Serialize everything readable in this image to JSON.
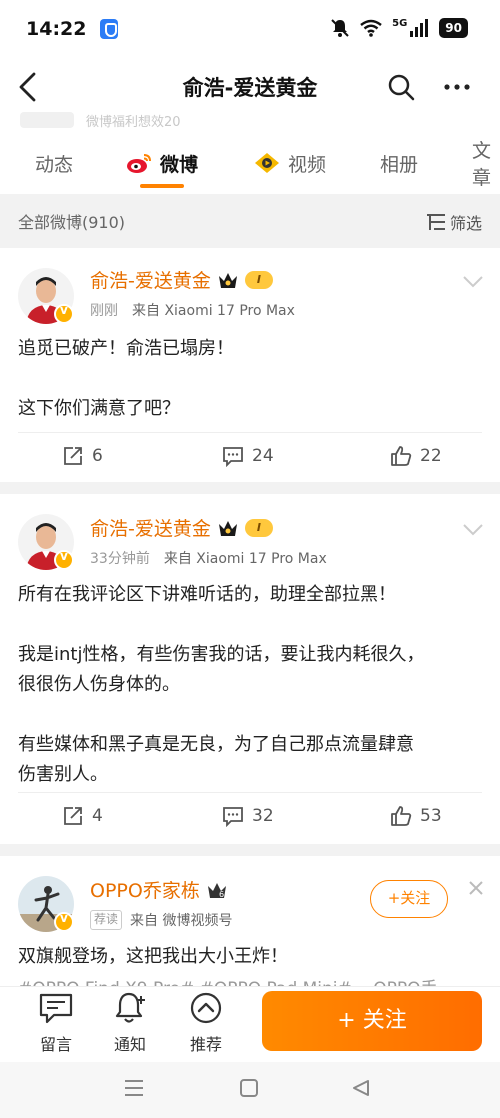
{
  "status": {
    "time": "14:22",
    "network": "5G",
    "battery": "90"
  },
  "header": {
    "title": "俞浩-爱送黄金"
  },
  "ghost": {
    "text": "微博福利想效20"
  },
  "tabs": [
    {
      "label": "动态"
    },
    {
      "label": "微博"
    },
    {
      "label": "视频"
    },
    {
      "label": "相册"
    },
    {
      "label": "文章"
    }
  ],
  "filter": {
    "count_label": "全部微博(910)",
    "filter_label": "筛选"
  },
  "posts": [
    {
      "author": "俞浩-爱送黄金",
      "level": "I",
      "time": "刚刚",
      "source": "来自 Xiaomi 17 Pro Max",
      "text": [
        "追觅已破产！俞浩已塌房！",
        "",
        "这下你们满意了吧？"
      ],
      "shares": "6",
      "comments": "24",
      "likes": "22"
    },
    {
      "author": "俞浩-爱送黄金",
      "level": "I",
      "time": "33分钟前",
      "source": "来自 Xiaomi 17 Pro Max",
      "text": [
        "所有在我评论区下讲难听话的，助理全部拉黑！",
        "",
        "我是intj性格，有些伤害我的话，要让我内耗很久，",
        "很很伤人伤身体的。",
        "",
        "有些媒体和黑子真是无良，为了自己那点流量肆意",
        "伤害别人。"
      ],
      "shares": "4",
      "comments": "32",
      "likes": "53"
    },
    {
      "author": "OPPO乔家栋",
      "rec_tag": "荐读",
      "source": "来自 微博视频号",
      "follow_label": "+关注",
      "text": [
        "双旗舰登场，这把我出大小王炸！"
      ],
      "tags": "#OPPO Find X9 Pro# #OPPO Pad Mini# ▭OPPO手"
    }
  ],
  "bottom_bar": {
    "comment_label": "留言",
    "notify_label": "通知",
    "recommend_label": "推荐",
    "follow_label": "+ 关注"
  },
  "colors": {
    "accent": "#ff8200",
    "author": "#e76f00"
  }
}
